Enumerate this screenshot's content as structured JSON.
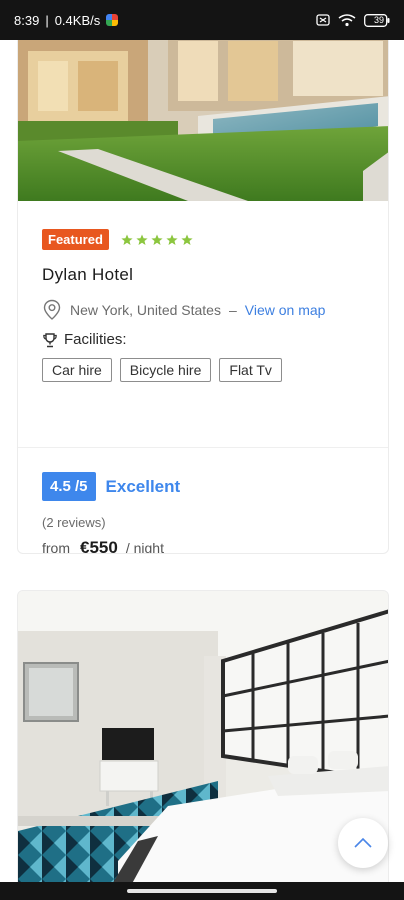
{
  "status_bar": {
    "time": "8:39",
    "speed": "0.4KB/s",
    "battery": "39"
  },
  "listings": [
    {
      "badge": "Featured",
      "rating_stars": 5,
      "name": "Dylan Hotel",
      "location": "New York, United States",
      "separator": "–",
      "map_link": "View on map",
      "facilities_label": "Facilities:",
      "facilities": [
        "Car hire",
        "Bicycle hire",
        "Flat Tv"
      ],
      "score": "4.5 /5",
      "score_text": "Excellent",
      "reviews": "(2 reviews)",
      "price_prefix": "from",
      "price": "€550",
      "price_suffix": "/ night"
    }
  ],
  "colors": {
    "badge": "#e8571f",
    "stars": "#8cc63f",
    "score": "#3e87ec",
    "link": "#3d7fe0"
  }
}
